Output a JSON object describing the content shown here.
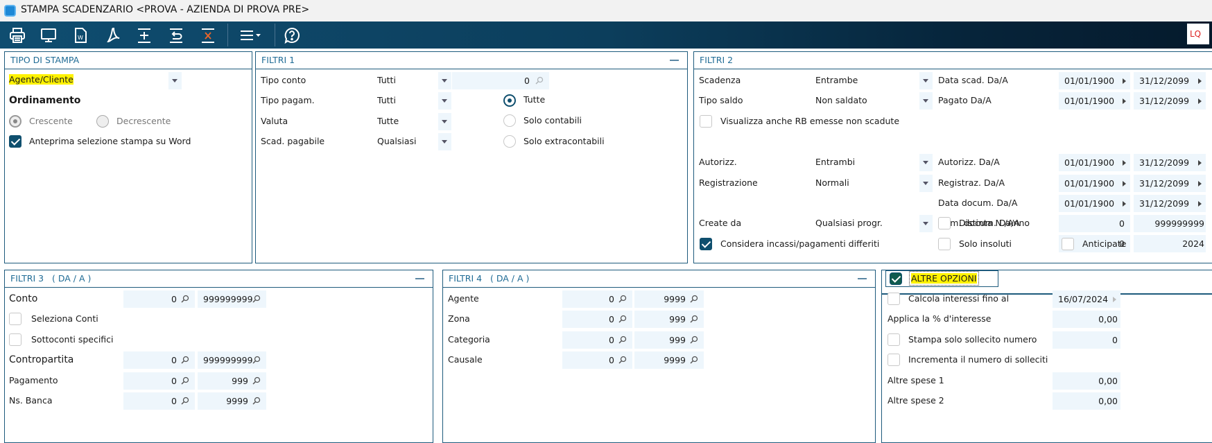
{
  "window": {
    "title": "STAMPA SCADENZARIO <PROVA - AZIENDA DI PROVA PRE>",
    "user_badge": "LQ"
  },
  "toolbar": {
    "items": [
      "print-icon",
      "monitor-icon",
      "word-icon",
      "pdf-icon",
      "add-line-icon",
      "undo-line-icon",
      "delete-line-icon",
      "menu-icon",
      "help-icon"
    ]
  },
  "colors": {
    "accent": "#1d5a7c",
    "field_bg": "#eef6fc",
    "highlight": "#fff200",
    "badge_text": "#dd2222"
  },
  "tipo_stampa": {
    "title": "TIPO DI STAMPA",
    "selected": "Agente/Cliente",
    "ordinamento": "Ordinamento",
    "crescente": "Crescente",
    "decrescente": "Decrescente",
    "ordinamento_value": "Crescente",
    "anteprima": "Anteprima selezione stampa su Word",
    "anteprima_checked": true
  },
  "filtri1": {
    "title": "FILTRI 1",
    "tipo_conto": {
      "label": "Tipo conto",
      "value": "Tutti",
      "code": "0"
    },
    "tipo_pagam": {
      "label": "Tipo pagam.",
      "value": "Tutti"
    },
    "valuta": {
      "label": "Valuta",
      "value": "Tutte"
    },
    "scad_pagabile": {
      "label": "Scad. pagabile",
      "value": "Qualsiasi"
    },
    "radios": [
      "Tutte",
      "Solo contabili",
      "Solo extracontabili"
    ],
    "radio_selected": "Tutte"
  },
  "filtri2": {
    "title": "FILTRI 2",
    "scadenza": {
      "label": "Scadenza",
      "value": "Entrambe"
    },
    "tipo_saldo": {
      "label": "Tipo saldo",
      "value": "Non saldato"
    },
    "visualizza_rb": {
      "label": "Visualizza anche RB emesse non scadute",
      "checked": false
    },
    "autorizz": {
      "label": "Autorizz.",
      "value": "Entrambi"
    },
    "registrazione": {
      "label": "Registrazione",
      "value": "Normali"
    },
    "create_da": {
      "label": "Create da",
      "value": "Qualsiasi progr."
    },
    "considera": {
      "label": "Considera incassi/pagamenti differiti",
      "checked": true
    },
    "solo_insoluti": {
      "label": "Solo insoluti",
      "checked": false
    },
    "anticipate": {
      "label": "Anticipate",
      "checked": false
    },
    "data_scad": {
      "label": "Data scad. Da/A",
      "from": "01/01/1900",
      "to": "31/12/2099"
    },
    "pagato": {
      "label": "Pagato Da/A",
      "from": "01/01/1900",
      "to": "31/12/2099"
    },
    "autorizz_da": {
      "label": "Autorizz. Da/A",
      "from": "01/01/1900",
      "to": "31/12/2099"
    },
    "registraz": {
      "label": "Registraz. Da/A",
      "from": "01/01/1900",
      "to": "31/12/2099"
    },
    "data_docum": {
      "label": "Data docum. Da/A",
      "from": "01/01/1900",
      "to": "31/12/2099"
    },
    "num_docum": {
      "label": "Num. docum. Da/A",
      "from": "0",
      "to": "999999999"
    },
    "distinta": {
      "label": "Distinta N./Anno",
      "checked": false,
      "from": "0",
      "to": "2024"
    }
  },
  "filtri3": {
    "title": "FILTRI 3   ( DA / A )",
    "conto": {
      "label": "Conto",
      "from": "0",
      "to": "999999999"
    },
    "seleziona_conti": {
      "label": "Seleziona Conti",
      "checked": false
    },
    "sottoconti": {
      "label": "Sottoconti specifici",
      "checked": false
    },
    "contropartita": {
      "label": "Contropartita",
      "from": "0",
      "to": "999999999"
    },
    "pagamento": {
      "label": "Pagamento",
      "from": "0",
      "to": "999"
    },
    "banca": {
      "label": "Ns. Banca",
      "from": "0",
      "to": "9999"
    }
  },
  "filtri4": {
    "title": "FILTRI 4   ( DA / A )",
    "agente": {
      "label": "Agente",
      "from": "0",
      "to": "9999"
    },
    "zona": {
      "label": "Zona",
      "from": "0",
      "to": "999"
    },
    "categoria": {
      "label": "Categoria",
      "from": "0",
      "to": "999"
    },
    "causale": {
      "label": "Causale",
      "from": "0",
      "to": "9999"
    }
  },
  "altre": {
    "title": "ALTRE OPZIONI",
    "enabled": true,
    "calcola": {
      "label": "Calcola interessi fino al",
      "checked": false,
      "value": "16/07/2024"
    },
    "applica": {
      "label": "Applica la % d'interesse",
      "value": "0,00"
    },
    "sollecito": {
      "label": "Stampa solo sollecito numero",
      "checked": false,
      "value": "0"
    },
    "incrementa": {
      "label": "Incrementa il numero di solleciti",
      "checked": false
    },
    "spese1": {
      "label": "Altre spese 1",
      "value": "0,00"
    },
    "spese2": {
      "label": "Altre spese 2",
      "value": "0,00"
    }
  }
}
